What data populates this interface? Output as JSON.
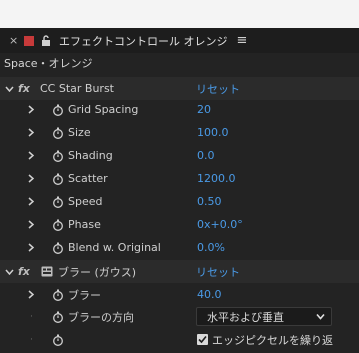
{
  "panel": {
    "close_glyph": "×",
    "title": "エフェクトコントロール オレンジ",
    "menu_glyph": "≡",
    "breadcrumb": "Space・オレンジ"
  },
  "effects": [
    {
      "fx_label": "fx",
      "name": "CC Star Burst",
      "reset_label": "リセット",
      "properties": [
        {
          "label": "Grid Spacing",
          "value": "20"
        },
        {
          "label": "Size",
          "value": "100.0"
        },
        {
          "label": "Shading",
          "value": "0.0"
        },
        {
          "label": "Scatter",
          "value": "1200.0"
        },
        {
          "label": "Speed",
          "value": "0.50"
        },
        {
          "label": "Phase",
          "value": "0x+0.0°"
        },
        {
          "label": "Blend w. Original",
          "value": "0.0%"
        }
      ]
    },
    {
      "fx_label": "fx",
      "name": "ブラー (ガウス)",
      "reset_label": "リセット",
      "properties": [
        {
          "label": "ブラー",
          "value": "40.0"
        },
        {
          "label": "ブラーの方向",
          "value": "水平および垂直"
        },
        {
          "label": "",
          "value": "エッジピクセルを繰り返"
        }
      ]
    }
  ],
  "colors": {
    "accent_blue": "#4a9ae6",
    "panel_swatch": "#c73a3a",
    "background": "#232323"
  }
}
